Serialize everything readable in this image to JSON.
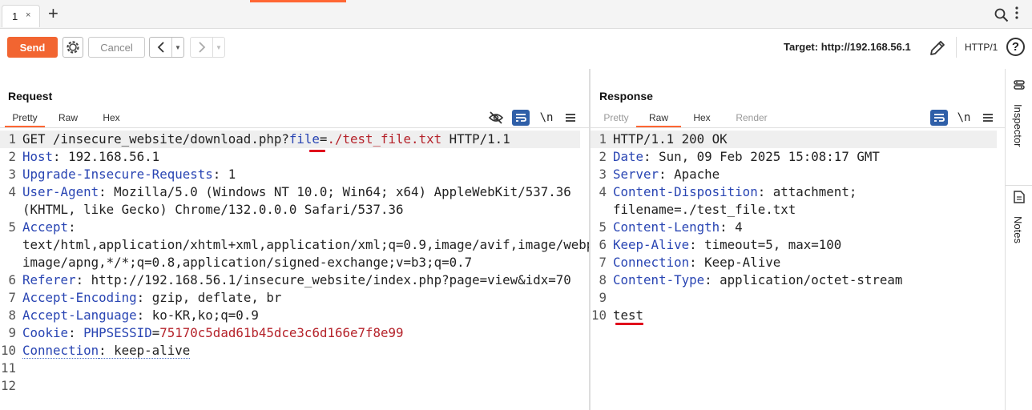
{
  "tabs": {
    "items": [
      {
        "label": "1",
        "close": "×"
      }
    ],
    "new_tab": "+"
  },
  "toolbar": {
    "send_label": "Send",
    "cancel_label": "Cancel",
    "back_glyph": "<",
    "forward_glyph": ">",
    "dropdown_glyph": "▼",
    "target_label": "Target: http://192.168.56.1",
    "protocol": "HTTP/1",
    "help_glyph": "?"
  },
  "request": {
    "title": "Request",
    "tabs": [
      "Pretty",
      "Raw",
      "Hex"
    ],
    "active_tab": "Pretty",
    "newline_label": "\\n",
    "lines": [
      {
        "n": "1",
        "segs": [
          [
            "v",
            "GET /insecure_website/download.php?"
          ],
          [
            "k",
            "file"
          ],
          [
            "v",
            "="
          ],
          [
            "r",
            "./test_file.txt"
          ],
          [
            "v",
            " HTTP/1.1"
          ]
        ]
      },
      {
        "n": "2",
        "segs": [
          [
            "k",
            "Host"
          ],
          [
            "v",
            ": 192.168.56.1"
          ]
        ]
      },
      {
        "n": "3",
        "segs": [
          [
            "k",
            "Upgrade-Insecure-Requests"
          ],
          [
            "v",
            ": 1"
          ]
        ]
      },
      {
        "n": "4",
        "segs": [
          [
            "k",
            "User-Agent"
          ],
          [
            "v",
            ": Mozilla/5.0 (Windows NT 10.0; Win64; x64) AppleWebKit/537.36"
          ]
        ]
      },
      {
        "n": "",
        "segs": [
          [
            "v",
            "(KHTML, like Gecko) Chrome/132.0.0.0 Safari/537.36"
          ]
        ]
      },
      {
        "n": "5",
        "segs": [
          [
            "k",
            "Accept"
          ],
          [
            "v",
            ":"
          ]
        ]
      },
      {
        "n": "",
        "segs": [
          [
            "v",
            "text/html,application/xhtml+xml,application/xml;q=0.9,image/avif,image/webp,"
          ]
        ]
      },
      {
        "n": "",
        "segs": [
          [
            "v",
            "image/apng,*/*;q=0.8,application/signed-exchange;v=b3;q=0.7"
          ]
        ]
      },
      {
        "n": "6",
        "segs": [
          [
            "k",
            "Referer"
          ],
          [
            "v",
            ": http://192.168.56.1/insecure_website/index.php?page=view&idx=70"
          ]
        ]
      },
      {
        "n": "7",
        "segs": [
          [
            "k",
            "Accept-Encoding"
          ],
          [
            "v",
            ": gzip, deflate, br"
          ]
        ]
      },
      {
        "n": "8",
        "segs": [
          [
            "k",
            "Accept-Language"
          ],
          [
            "v",
            ": ko-KR,ko;q=0.9"
          ]
        ]
      },
      {
        "n": "9",
        "segs": [
          [
            "k",
            "Cookie"
          ],
          [
            "v",
            ": "
          ],
          [
            "k",
            "PHPSESSID"
          ],
          [
            "v",
            "="
          ],
          [
            "r",
            "75170c5dad61b45dce3c6d166e7f8e99"
          ]
        ]
      },
      {
        "n": "10",
        "segs": [
          [
            "kd",
            "Connection"
          ],
          [
            "vd",
            ": keep-alive"
          ]
        ]
      },
      {
        "n": "11",
        "segs": []
      },
      {
        "n": "12",
        "segs": []
      }
    ]
  },
  "response": {
    "title": "Response",
    "tabs": [
      "Pretty",
      "Raw",
      "Hex",
      "Render"
    ],
    "active_tab": "Raw",
    "newline_label": "\\n",
    "lines": [
      {
        "n": "1",
        "segs": [
          [
            "v",
            "HTTP/1.1 200 OK"
          ]
        ]
      },
      {
        "n": "2",
        "segs": [
          [
            "k",
            "Date"
          ],
          [
            "v",
            ": Sun, 09 Feb 2025 15:08:17 GMT"
          ]
        ]
      },
      {
        "n": "3",
        "segs": [
          [
            "k",
            "Server"
          ],
          [
            "v",
            ": Apache"
          ]
        ]
      },
      {
        "n": "4",
        "segs": [
          [
            "k",
            "Content-Disposition"
          ],
          [
            "v",
            ": attachment;"
          ]
        ]
      },
      {
        "n": "",
        "segs": [
          [
            "v",
            "filename=./test_file.txt"
          ]
        ]
      },
      {
        "n": "5",
        "segs": [
          [
            "k",
            "Content-Length"
          ],
          [
            "v",
            ": 4"
          ]
        ]
      },
      {
        "n": "6",
        "segs": [
          [
            "k",
            "Keep-Alive"
          ],
          [
            "v",
            ": timeout=5, max=100"
          ]
        ]
      },
      {
        "n": "7",
        "segs": [
          [
            "k",
            "Connection"
          ],
          [
            "v",
            ": Keep-Alive"
          ]
        ]
      },
      {
        "n": "8",
        "segs": [
          [
            "k",
            "Content-Type"
          ],
          [
            "v",
            ": application/octet-stream"
          ]
        ]
      },
      {
        "n": "9",
        "segs": []
      },
      {
        "n": "10",
        "segs": [
          [
            "v",
            "test"
          ]
        ]
      }
    ]
  },
  "side_panel": {
    "inspector_label": "Inspector",
    "notes_label": "Notes"
  },
  "colors": {
    "accent": "#ff6633",
    "send": "#f26531",
    "key": "#2945b3",
    "value_red": "#b5222a",
    "annotation": "#e0001b",
    "toggle_blue": "#2f5fa8"
  },
  "icons": [
    "search-icon",
    "more-icon",
    "gear-icon",
    "pencil-icon",
    "help-icon",
    "hide-icon",
    "wrap-icon",
    "menu-icon",
    "inspector-icon",
    "notes-icon"
  ]
}
